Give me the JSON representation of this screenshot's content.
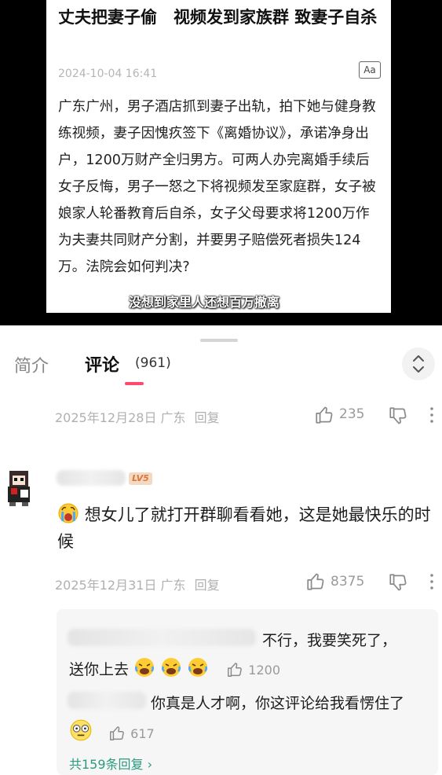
{
  "video": {
    "article": {
      "title": "丈夫把妻子偷　视频发到家族群 致妻子自杀",
      "date": "2024-10-04 16:41",
      "font_button": "Aa",
      "body": "广东广州，男子酒店抓到妻子出轨，拍下她与健身教练视频，妻子因愧疚签下《离婚协议》，承诺净身出户，1200万财产全归男方。可两人办完离婚手续后女子反悔，男子一怒之下将视频发至家庭群，女子被娘家人轮番教育后自杀，女子父母要求将1200万作为夫妻共同财产分割，并要男子赔偿死者损失124万。法院会如何判决?"
    },
    "subtitle": "没想到家里人还想百万撤离"
  },
  "tabs": {
    "intro": "简介",
    "comments": "评论",
    "comment_count": "(961)"
  },
  "comments": [
    {
      "meta": "2025年12月28日 广东",
      "reply_label": "回复",
      "likes": "235"
    },
    {
      "level": "LV5",
      "text": "想女儿了就打开群聊看看她，这是她最快乐的时候",
      "meta": "2025年12月31日 广东",
      "reply_label": "回复",
      "likes": "8375",
      "replies": [
        {
          "text_before": "不行，我要笑死了，",
          "text_after": "送你上去",
          "likes": "1200"
        },
        {
          "text": "你真是人才啊，你这评论给我看愣住了",
          "likes": "617"
        }
      ],
      "more_replies": "共159条回复 ›"
    }
  ],
  "colors": {
    "accent": "#ff4a6e",
    "link": "#2b9a7e",
    "muted": "#b0b0b0"
  }
}
